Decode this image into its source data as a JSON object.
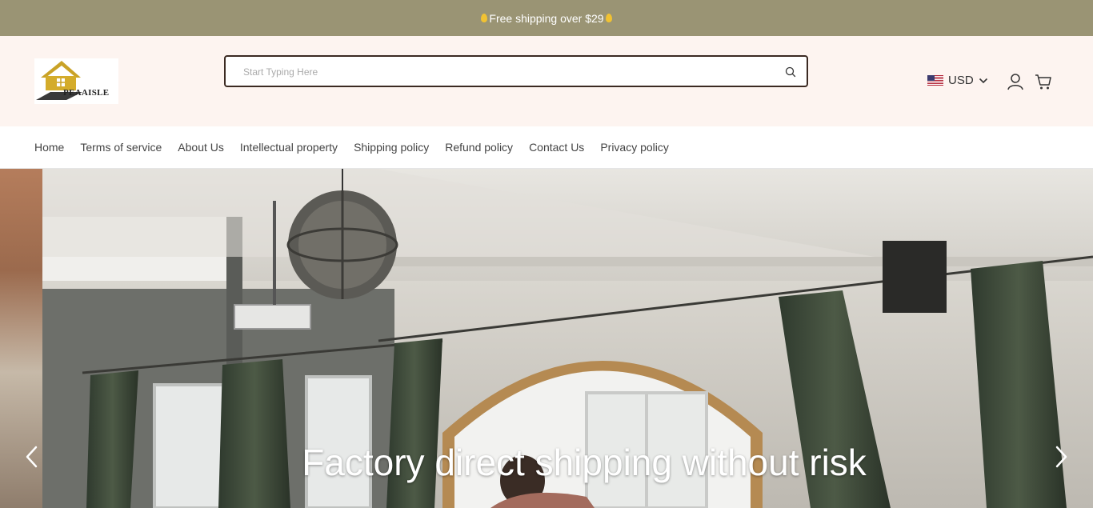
{
  "announcement": {
    "text": "Free shipping over $29"
  },
  "header": {
    "logo_text": "PEAAISLE",
    "search": {
      "placeholder": "Start Typing Here"
    },
    "currency": {
      "selected": "USD"
    }
  },
  "nav": {
    "items": [
      {
        "label": "Home"
      },
      {
        "label": "Terms of service"
      },
      {
        "label": "About Us"
      },
      {
        "label": "Intellectual property"
      },
      {
        "label": "Shipping policy"
      },
      {
        "label": "Refund policy"
      },
      {
        "label": "Contact Us"
      },
      {
        "label": "Privacy policy"
      }
    ]
  },
  "hero": {
    "caption": "Factory direct shipping without risk"
  },
  "colors": {
    "announcement_bg": "#9a9474",
    "header_bg": "#fdf4f0",
    "search_border": "#3b2a22",
    "drop_accent": "#f1c232"
  },
  "icons": [
    "search-icon",
    "us-flag-icon",
    "chevron-down-icon",
    "account-icon",
    "cart-icon",
    "arrow-left-icon",
    "arrow-right-icon"
  ]
}
